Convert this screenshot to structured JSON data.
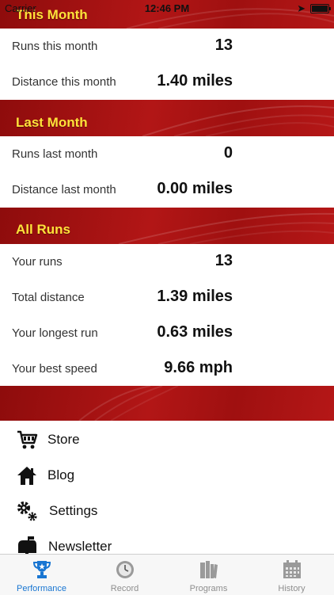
{
  "status_bar": {
    "carrier": "Carrier",
    "time": "12:46 PM"
  },
  "sections": [
    {
      "title": "This Month",
      "rows": [
        {
          "label": "Runs this month",
          "value": "13"
        },
        {
          "label": "Distance this month",
          "value": "1.40 miles"
        }
      ]
    },
    {
      "title": "Last Month",
      "rows": [
        {
          "label": "Runs last month",
          "value": "0"
        },
        {
          "label": "Distance last month",
          "value": "0.00 miles"
        }
      ]
    },
    {
      "title": "All Runs",
      "rows": [
        {
          "label": "Your runs",
          "value": "13"
        },
        {
          "label": "Total distance",
          "value": "1.39 miles"
        },
        {
          "label": "Your longest run",
          "value": "0.63 miles"
        },
        {
          "label": "Your best speed",
          "value": "9.66 mph"
        }
      ]
    }
  ],
  "menu": [
    {
      "label": "Store",
      "icon": "cart-icon"
    },
    {
      "label": "Blog",
      "icon": "home-icon"
    },
    {
      "label": "Settings",
      "icon": "gears-icon"
    },
    {
      "label": "Newsletter",
      "icon": "mailbox-icon"
    }
  ],
  "tabs": [
    {
      "label": "Performance",
      "icon": "trophy-icon",
      "active": true
    },
    {
      "label": "Record",
      "icon": "stopwatch-icon",
      "active": false
    },
    {
      "label": "Programs",
      "icon": "books-icon",
      "active": false
    },
    {
      "label": "History",
      "icon": "calendar-icon",
      "active": false
    }
  ],
  "colors": {
    "header_red": "#a51212",
    "header_title_yellow": "#ffe23a",
    "tab_active_blue": "#1976d2",
    "tab_inactive_gray": "#8e8e8e"
  }
}
